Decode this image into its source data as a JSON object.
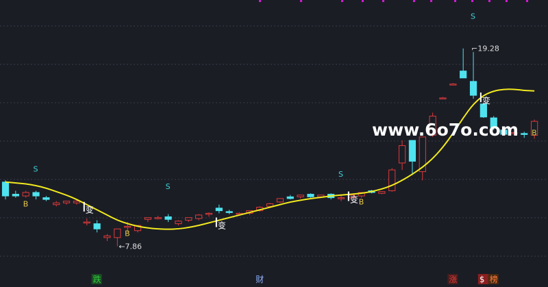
{
  "watermark": "www.6o7o.com",
  "colors": {
    "background": "#1b1d25",
    "up": "#e03a3a",
    "down": "#4fe3ef",
    "ma": "#f2ea1f",
    "signal_s": "#3fd3d9",
    "signal_b": "#e6c84a",
    "gridline": "#3a3d47",
    "magenta": "#d01bd4",
    "text": "#ffffff",
    "price_label": "#dddddd"
  },
  "chart_data": {
    "type": "candlestick",
    "price_high_label": "19.28",
    "price_low_label": "7.86",
    "ylim": [
      6.5,
      21.5
    ],
    "candles": [
      {
        "o": 11.6,
        "h": 11.7,
        "l": 10.6,
        "c": 10.8
      },
      {
        "o": 10.9,
        "h": 11.1,
        "l": 10.7,
        "c": 10.8
      },
      {
        "o": 10.8,
        "h": 11.1,
        "l": 10.7,
        "c": 11.0
      },
      {
        "o": 11.0,
        "h": 11.1,
        "l": 10.6,
        "c": 10.8
      },
      {
        "o": 10.7,
        "h": 10.8,
        "l": 10.5,
        "c": 10.6
      },
      {
        "o": 10.3,
        "h": 10.5,
        "l": 10.2,
        "c": 10.4
      },
      {
        "o": 10.4,
        "h": 10.5,
        "l": 10.3,
        "c": 10.5
      },
      {
        "o": 10.4,
        "h": 10.6,
        "l": 10.3,
        "c": 10.5
      },
      {
        "o": 9.3,
        "h": 9.5,
        "l": 9.1,
        "c": 9.3
      },
      {
        "o": 9.2,
        "h": 9.4,
        "l": 8.7,
        "c": 8.9
      },
      {
        "o": 8.4,
        "h": 8.6,
        "l": 8.2,
        "c": 8.5
      },
      {
        "o": 8.4,
        "h": 8.9,
        "l": 7.9,
        "c": 8.9
      },
      {
        "o": 9.0,
        "h": 9.3,
        "l": 8.7,
        "c": 9.05
      },
      {
        "o": 8.8,
        "h": 9.1,
        "l": 8.7,
        "c": 9.1
      },
      {
        "o": 9.45,
        "h": 9.55,
        "l": 9.3,
        "c": 9.55
      },
      {
        "o": 9.55,
        "h": 9.65,
        "l": 9.45,
        "c": 9.55
      },
      {
        "o": 9.6,
        "h": 9.75,
        "l": 9.3,
        "c": 9.45
      },
      {
        "o": 9.2,
        "h": 9.4,
        "l": 9.1,
        "c": 9.35
      },
      {
        "o": 9.4,
        "h": 9.55,
        "l": 9.3,
        "c": 9.55
      },
      {
        "o": 9.5,
        "h": 9.75,
        "l": 9.4,
        "c": 9.7
      },
      {
        "o": 9.75,
        "h": 9.85,
        "l": 9.6,
        "c": 9.8
      },
      {
        "o": 10.1,
        "h": 10.3,
        "l": 9.8,
        "c": 9.95
      },
      {
        "o": 9.9,
        "h": 10.0,
        "l": 9.75,
        "c": 9.85
      },
      {
        "o": 9.75,
        "h": 9.85,
        "l": 9.7,
        "c": 9.8
      },
      {
        "o": 9.8,
        "h": 9.95,
        "l": 9.7,
        "c": 9.95
      },
      {
        "o": 9.95,
        "h": 10.2,
        "l": 9.9,
        "c": 10.15
      },
      {
        "o": 10.2,
        "h": 10.4,
        "l": 10.1,
        "c": 10.35
      },
      {
        "o": 10.45,
        "h": 10.65,
        "l": 10.4,
        "c": 10.65
      },
      {
        "o": 10.75,
        "h": 10.85,
        "l": 10.6,
        "c": 10.65
      },
      {
        "o": 10.75,
        "h": 10.85,
        "l": 10.65,
        "c": 10.85
      },
      {
        "o": 10.9,
        "h": 10.95,
        "l": 10.7,
        "c": 10.75
      },
      {
        "o": 10.75,
        "h": 10.85,
        "l": 10.7,
        "c": 10.85
      },
      {
        "o": 10.9,
        "h": 10.95,
        "l": 10.6,
        "c": 10.7
      },
      {
        "o": 10.7,
        "h": 10.85,
        "l": 10.5,
        "c": 10.7
      },
      {
        "o": 10.7,
        "h": 10.9,
        "l": 10.6,
        "c": 10.85
      },
      {
        "o": 10.8,
        "h": 11.0,
        "l": 10.7,
        "c": 11.0
      },
      {
        "o": 11.1,
        "h": 11.15,
        "l": 10.95,
        "c": 11.0
      },
      {
        "o": 10.95,
        "h": 11.05,
        "l": 10.9,
        "c": 11.05
      },
      {
        "o": 11.1,
        "h": 12.4,
        "l": 11.05,
        "c": 12.3
      },
      {
        "o": 12.7,
        "h": 14.0,
        "l": 12.3,
        "c": 13.7
      },
      {
        "o": 14.0,
        "h": 14.0,
        "l": 12.0,
        "c": 12.8
      },
      {
        "o": 12.2,
        "h": 14.2,
        "l": 11.7,
        "c": 14.2
      },
      {
        "o": 14.3,
        "h": 15.6,
        "l": 14.2,
        "c": 15.4
      },
      {
        "o": 16.4,
        "h": 16.5,
        "l": 16.4,
        "c": 16.45
      },
      {
        "o": 17.2,
        "h": 17.3,
        "l": 17.2,
        "c": 17.25
      },
      {
        "o": 18.0,
        "h": 19.3,
        "l": 17.7,
        "c": 17.6
      },
      {
        "o": 17.4,
        "h": 19.1,
        "l": 16.4,
        "c": 16.6
      },
      {
        "o": 16.1,
        "h": 16.2,
        "l": 15.3,
        "c": 15.35
      },
      {
        "o": 15.3,
        "h": 15.4,
        "l": 14.6,
        "c": 14.75
      },
      {
        "o": 14.6,
        "h": 14.7,
        "l": 14.3,
        "c": 14.35
      },
      {
        "o": 14.4,
        "h": 14.5,
        "l": 14.3,
        "c": 14.45
      },
      {
        "o": 14.4,
        "h": 14.5,
        "l": 14.15,
        "c": 14.35
      },
      {
        "o": 14.3,
        "h": 15.2,
        "l": 14.1,
        "c": 15.1
      }
    ],
    "ma": [
      11.6,
      11.55,
      11.5,
      11.4,
      11.25,
      11.05,
      10.85,
      10.6,
      10.3,
      10.0,
      9.7,
      9.4,
      9.2,
      9.05,
      8.95,
      8.9,
      8.88,
      8.9,
      8.98,
      9.1,
      9.25,
      9.4,
      9.55,
      9.7,
      9.85,
      10.0,
      10.15,
      10.3,
      10.45,
      10.55,
      10.65,
      10.72,
      10.8,
      10.85,
      10.9,
      10.95,
      11.05,
      11.2,
      11.4,
      11.7,
      12.05,
      12.45,
      12.95,
      13.6,
      14.4,
      15.3,
      16.1,
      16.6,
      16.85,
      16.95,
      16.95,
      16.88,
      16.85
    ],
    "signals": [
      {
        "label": "S",
        "i": 3,
        "price": 12.2
      },
      {
        "label": "B",
        "i": 2,
        "price": 10.2
      },
      {
        "label": "S",
        "i": 16,
        "price": 11.2
      },
      {
        "label": "B",
        "i": 12,
        "price": 8.5
      },
      {
        "label": "S",
        "i": 33,
        "price": 11.9
      },
      {
        "label": "B",
        "i": 35,
        "price": 10.3
      },
      {
        "label": "S",
        "i": 46,
        "price": 21.0
      },
      {
        "label": "B",
        "i": 52,
        "price": 14.3
      }
    ],
    "change_markers": [
      {
        "label": "变",
        "i": 8
      },
      {
        "label": "变",
        "i": 21
      },
      {
        "label": "变",
        "i": 34
      },
      {
        "label": "变",
        "i": 47
      }
    ],
    "bottom_labels": [
      {
        "label": "跌",
        "color": "#2ccd3e",
        "i": 9,
        "bg": "#1d4a22"
      },
      {
        "label": "财",
        "color": "#8fb3ff",
        "i": 25,
        "bg": ""
      },
      {
        "label": "涨",
        "color": "#e03a3a",
        "i": 44,
        "bg": "#4a1d1d"
      },
      {
        "label": "$",
        "color": "#ffffff",
        "i": 47,
        "bg": "#8b1f1f"
      },
      {
        "label": "榜",
        "color": "#ff7b3a",
        "i": 48,
        "bg": "#4a2a12"
      }
    ]
  }
}
